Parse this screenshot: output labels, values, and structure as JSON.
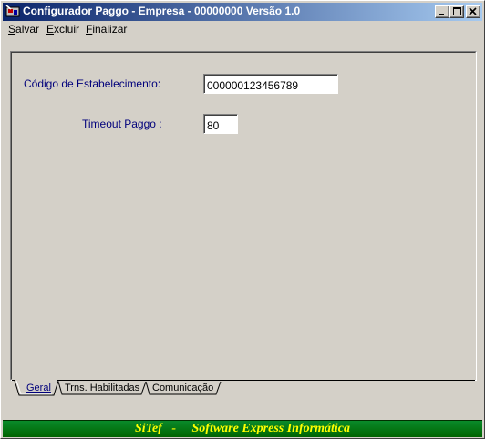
{
  "window": {
    "title": "Configurador Paggo - Empresa - 00000000  Versão 1.0",
    "icon": "app-icon"
  },
  "menu": {
    "items": [
      {
        "label_rest": "alvar",
        "accel": "S"
      },
      {
        "label_rest": "xcluir",
        "accel": "E"
      },
      {
        "label_rest": "inalizar",
        "accel": "F"
      }
    ]
  },
  "form": {
    "establishment_label": "Código de Estabelecimento:",
    "establishment_value": "000000123456789",
    "timeout_label": "Timeout Paggo :",
    "timeout_value": "80"
  },
  "tabs": [
    {
      "label": "Geral",
      "active": true
    },
    {
      "label": "Trns. Habilitadas",
      "active": false
    },
    {
      "label": "Comunicação",
      "active": false
    }
  ],
  "status": {
    "text": "SiTef   -     Software Express Informática",
    "colors": {
      "background": "#006400",
      "text": "#ffff00"
    }
  },
  "colors": {
    "titlebar_start": "#0a246a",
    "titlebar_end": "#a6caf0",
    "label_text": "#00007b",
    "face": "#d4d0c8"
  }
}
